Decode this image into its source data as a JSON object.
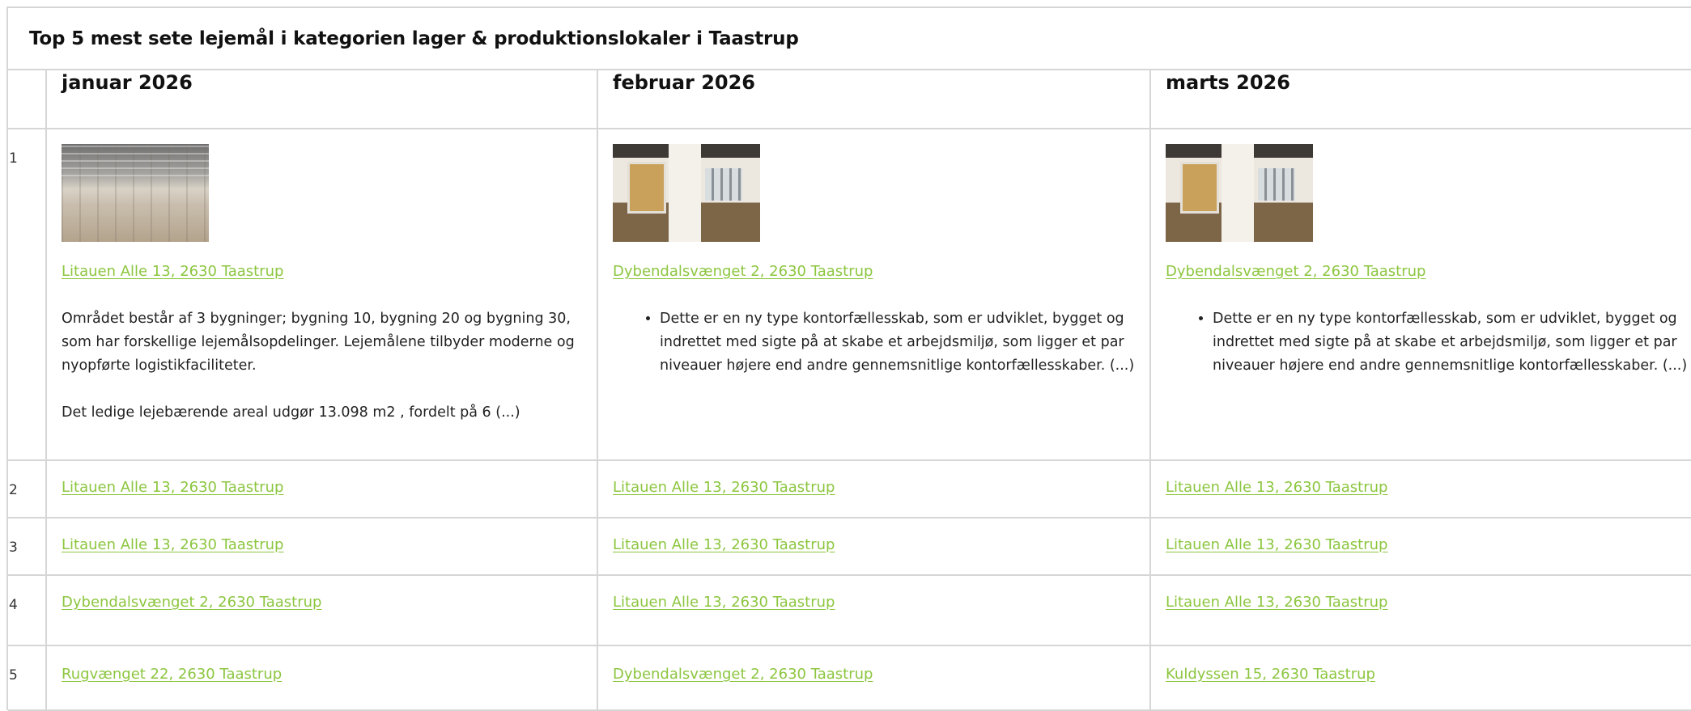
{
  "title": "Top 5 mest sete lejemål i kategorien lager & produktionslokaler i Taastrup",
  "columns": [
    "januar 2026",
    "februar 2026",
    "marts 2026"
  ],
  "ranks": [
    "1",
    "2",
    "3",
    "4",
    "5"
  ],
  "first_row": [
    {
      "image": "warehouse-photo",
      "address": "Litauen Alle 13, 2630 Taastrup",
      "desc_paragraphs": [
        "Området består af 3 bygninger; bygning 10, bygning 20 og bygning 30, som har forskellige lejemålsopdelinger. Lejemålene tilbyder moderne og nyopførte logistikfaciliteter.",
        "Det ledige lejebærende areal udgør 13.098 m2 , fordelt på 6 (...)"
      ]
    },
    {
      "image": "office-photo",
      "address": "Dybendalsvænget 2, 2630 Taastrup",
      "bullet": "Dette er en ny type kontorfællesskab, som er udviklet, bygget og indrettet med sigte på at skabe et arbejdsmiljø, som ligger et par niveauer højere end andre gennemsnitlige kontorfællesskaber. (...)"
    },
    {
      "image": "office-photo",
      "address": "Dybendalsvænget 2, 2630 Taastrup",
      "bullet": "Dette er en ny type kontorfællesskab, som er udviklet, bygget og indrettet med sigte på at skabe et arbejdsmiljø, som ligger et par niveauer højere end andre gennemsnitlige kontorfællesskaber. (...)"
    }
  ],
  "rows": [
    [
      "Litauen Alle 13, 2630 Taastrup",
      "Litauen Alle 13, 2630 Taastrup",
      "Litauen Alle 13, 2630 Taastrup"
    ],
    [
      "Litauen Alle 13, 2630 Taastrup",
      "Litauen Alle 13, 2630 Taastrup",
      "Litauen Alle 13, 2630 Taastrup"
    ],
    [
      "Dybendalsvænget 2, 2630 Taastrup",
      "Litauen Alle 13, 2630 Taastrup",
      "Litauen Alle 13, 2630 Taastrup"
    ],
    [
      "Rugvænget 22, 2630 Taastrup",
      "Dybendalsvænget 2, 2630 Taastrup",
      "Kuldyssen 15, 2630 Taastrup"
    ]
  ],
  "colors": {
    "link": "#8cc63f",
    "border": "#d6d6d6"
  }
}
